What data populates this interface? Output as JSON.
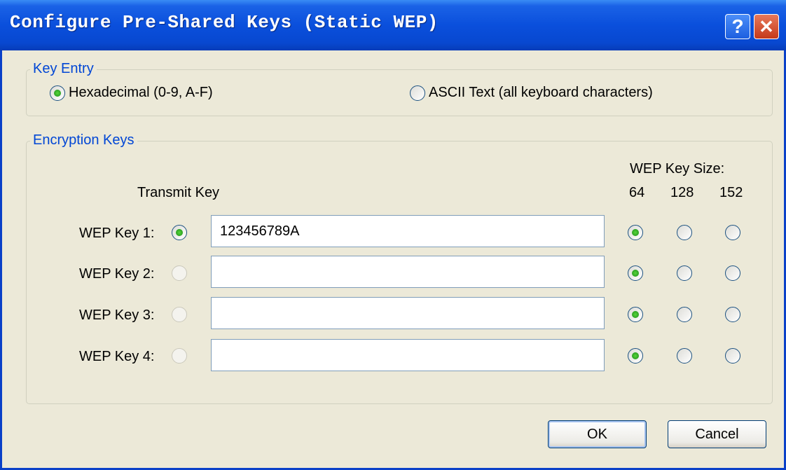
{
  "window": {
    "title": "Configure Pre-Shared Keys (Static WEP)",
    "help_label": "?",
    "close_label": "✕"
  },
  "key_entry": {
    "legend": "Key Entry",
    "options": [
      {
        "label": "Hexadecimal (0-9, A-F)",
        "selected": true
      },
      {
        "label": "ASCII Text (all keyboard characters)",
        "selected": false
      }
    ]
  },
  "encryption_keys": {
    "legend": "Encryption Keys",
    "transmit_key_header": "Transmit Key",
    "key_size_header": "WEP Key Size:",
    "sizes": [
      "64",
      "128",
      "152"
    ],
    "keys": [
      {
        "label": "WEP Key 1:",
        "value": "123456789A",
        "transmit_selected": true,
        "transmit_enabled": true,
        "size": "64"
      },
      {
        "label": "WEP Key 2:",
        "value": "",
        "transmit_selected": false,
        "transmit_enabled": false,
        "size": "64"
      },
      {
        "label": "WEP Key 3:",
        "value": "",
        "transmit_selected": false,
        "transmit_enabled": false,
        "size": "64"
      },
      {
        "label": "WEP Key 4:",
        "value": "",
        "transmit_selected": false,
        "transmit_enabled": false,
        "size": "64"
      }
    ]
  },
  "buttons": {
    "ok": "OK",
    "cancel": "Cancel"
  },
  "colors": {
    "titlebar": "#0a4fdc",
    "legend_text": "#0046d5",
    "dialog_bg": "#ece9d8",
    "radio_dot": "#21a121"
  }
}
